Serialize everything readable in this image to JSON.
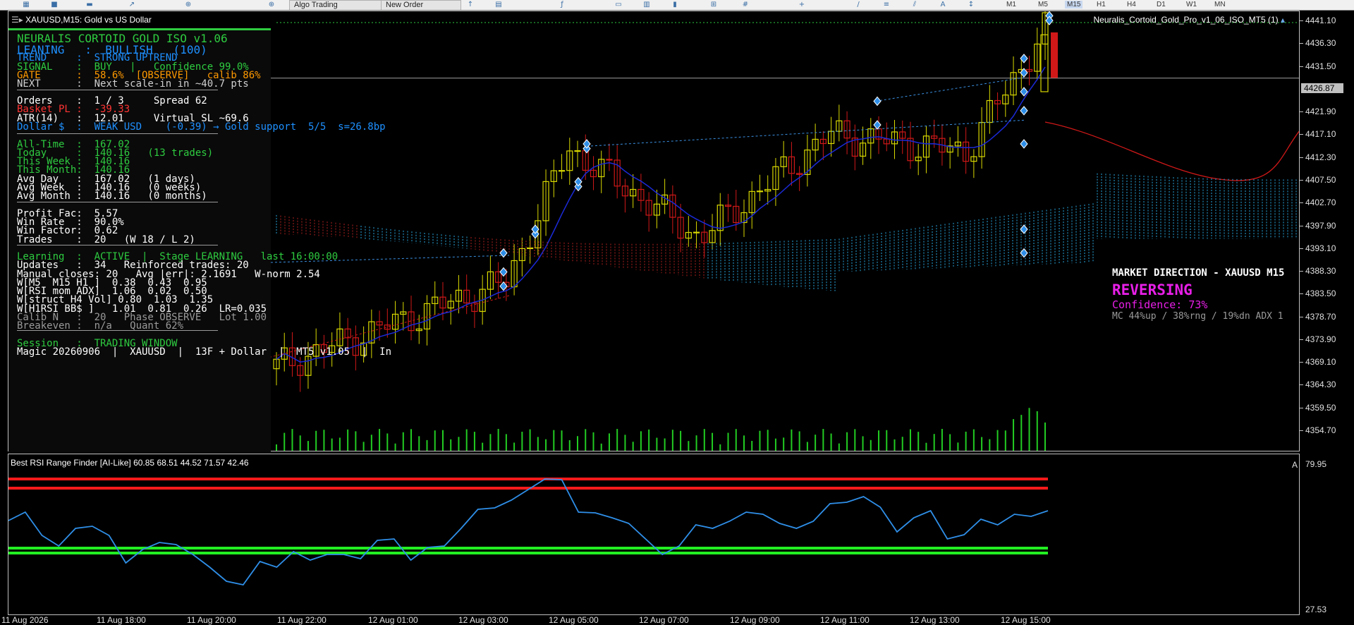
{
  "toolbar": {
    "algo_trading_label": "Algo Trading",
    "new_order_label": "New Order",
    "timeframes": [
      "M1",
      "M5",
      "M15",
      "H1",
      "H4",
      "D1",
      "W1",
      "MN"
    ],
    "active_timeframe": "M15"
  },
  "chart": {
    "symbol_title": "XAUUSD,M15:  Gold vs US Dollar",
    "ea_name": "Neuralis_Cortoid_Gold_Pro_v1_06_ISO_MT5 (1)",
    "price_labels": [
      "4441.10",
      "4436.30",
      "4431.50",
      "4421.90",
      "4417.10",
      "4412.30",
      "4407.50",
      "4402.70",
      "4397.90",
      "4393.10",
      "4388.30",
      "4383.50",
      "4378.70",
      "4373.90",
      "4369.10",
      "4364.30",
      "4359.50",
      "4354.70"
    ],
    "current_price": "4426.87",
    "time_labels": [
      "11 Aug 2026",
      "11 Aug 18:00",
      "11 Aug 20:00",
      "11 Aug 22:00",
      "12 Aug 01:00",
      "12 Aug 03:00",
      "12 Aug 05:00",
      "12 Aug 07:00",
      "12 Aug 09:00",
      "12 Aug 11:00",
      "12 Aug 13:00",
      "12 Aug 15:00"
    ],
    "colors": {
      "bull": "#d8d800",
      "bear": "#d01818",
      "ma": "#1b2ad8",
      "cloud": "#29a9e0",
      "cloud_red": "#b02020",
      "volume": "#22cc22"
    }
  },
  "hud": {
    "lines": [
      {
        "text": "NEURALIS CORTOID GOLD ISO v1.06",
        "color": "#2ecc40",
        "size": 16
      },
      {
        "text": "LEANING   :  BULLISH   (100)",
        "color": "#1e90ff",
        "size": 16
      },
      {
        "text": "TREND     :  STRONG UPTREND",
        "color": "#1e90ff"
      },
      {
        "text": "SIGNAL    :  BUY   |   Confidence 99.0%",
        "color": "#2ecc40"
      },
      {
        "text": "GATE      :  58.6%  [OBSERVE]   calib 86%",
        "color": "#ff9900"
      },
      {
        "text": "NEXT      :  Next scale-in in ~40.7 pts",
        "color": "#d0d0d0"
      },
      {
        "text": "Orders    :  1 / 3     Spread 62",
        "color": "#ffffff"
      },
      {
        "text": "Basket PL :  -39.33",
        "color": "#ff3333"
      },
      {
        "text": "ATR(14)   :  12.01     Virtual SL ~69.6",
        "color": "#ffffff"
      },
      {
        "text": "Dollar $  :  WEAK USD    (-0.39) → Gold support  5/5  s=26.8bp",
        "color": "#1e90ff"
      },
      {
        "text": "All-Time  :  167.02",
        "color": "#2ecc40"
      },
      {
        "text": "Today     :  140.16   (13 trades)",
        "color": "#2ecc40"
      },
      {
        "text": "This Week :  140.16",
        "color": "#2ecc40"
      },
      {
        "text": "This Month:  140.16",
        "color": "#2ecc40"
      },
      {
        "text": "Avg Day   :  167.02   (1 days)",
        "color": "#ffffff"
      },
      {
        "text": "Avg Week  :  140.16   (0 weeks)",
        "color": "#ffffff"
      },
      {
        "text": "Avg Month :  140.16   (0 months)",
        "color": "#ffffff"
      },
      {
        "text": "Profit Fac:  5.57",
        "color": "#ffffff"
      },
      {
        "text": "Win Rate  :  90.0%",
        "color": "#ffffff"
      },
      {
        "text": "Win Factor:  0.62",
        "color": "#ffffff"
      },
      {
        "text": "Trades    :  20   (W 18 / L 2)",
        "color": "#ffffff"
      },
      {
        "text": "Learning  :  ACTIVE  |  Stage LEARNING   last 16:00:00",
        "color": "#2ecc40"
      },
      {
        "text": "Updates   :  34   Reinforced trades: 20",
        "color": "#ffffff"
      },
      {
        "text": "Manual closes: 20   Avg |err|: 2.1691   W-norm 2.54",
        "color": "#ffffff"
      },
      {
        "text": "W[M5  M15 H1 ]  0.38  0.43  0.95",
        "color": "#ffffff"
      },
      {
        "text": "W[RSI mom ADX]  1.06  0.02  0.50",
        "color": "#ffffff"
      },
      {
        "text": "W[struct H4 Vol] 0.80  1.03  1.35",
        "color": "#ffffff"
      },
      {
        "text": "W[H1RSI BB$ ]   1.01  0.81  0.26  LR=0.035",
        "color": "#ffffff"
      },
      {
        "text": "Calib N   :  20   Phase OBSERVE   Lot 1.00",
        "color": "#9a9a9a"
      },
      {
        "text": "Breakeven :  n/a   Quant 62%",
        "color": "#9a9a9a"
      },
      {
        "text": "Session   :  TRADING WINDOW",
        "color": "#2ecc40"
      },
      {
        "text": "Magic 20260906  |  XAUUSD  |  13F + Dollar  |  MT5 v1.05  |  In",
        "color": "#ffffff"
      }
    ]
  },
  "market_direction": {
    "title": "MARKET DIRECTION - XAUUSD M15",
    "state": "REVERSING",
    "confidence": "Confidence: 73%",
    "detail": "MC 44%up / 38%rng / 19%dn   ADX 1"
  },
  "rsi": {
    "title": "Best RSI Range Finder [AI-Like] 60.85 68.51 44.52 71.57 42.46",
    "max_label": "79.95",
    "min_label": "27.53",
    "corner_label": "A",
    "colors": {
      "line": "#2f8fe8",
      "upper": "#ff1a1a",
      "lower": "#22ee22"
    }
  }
}
